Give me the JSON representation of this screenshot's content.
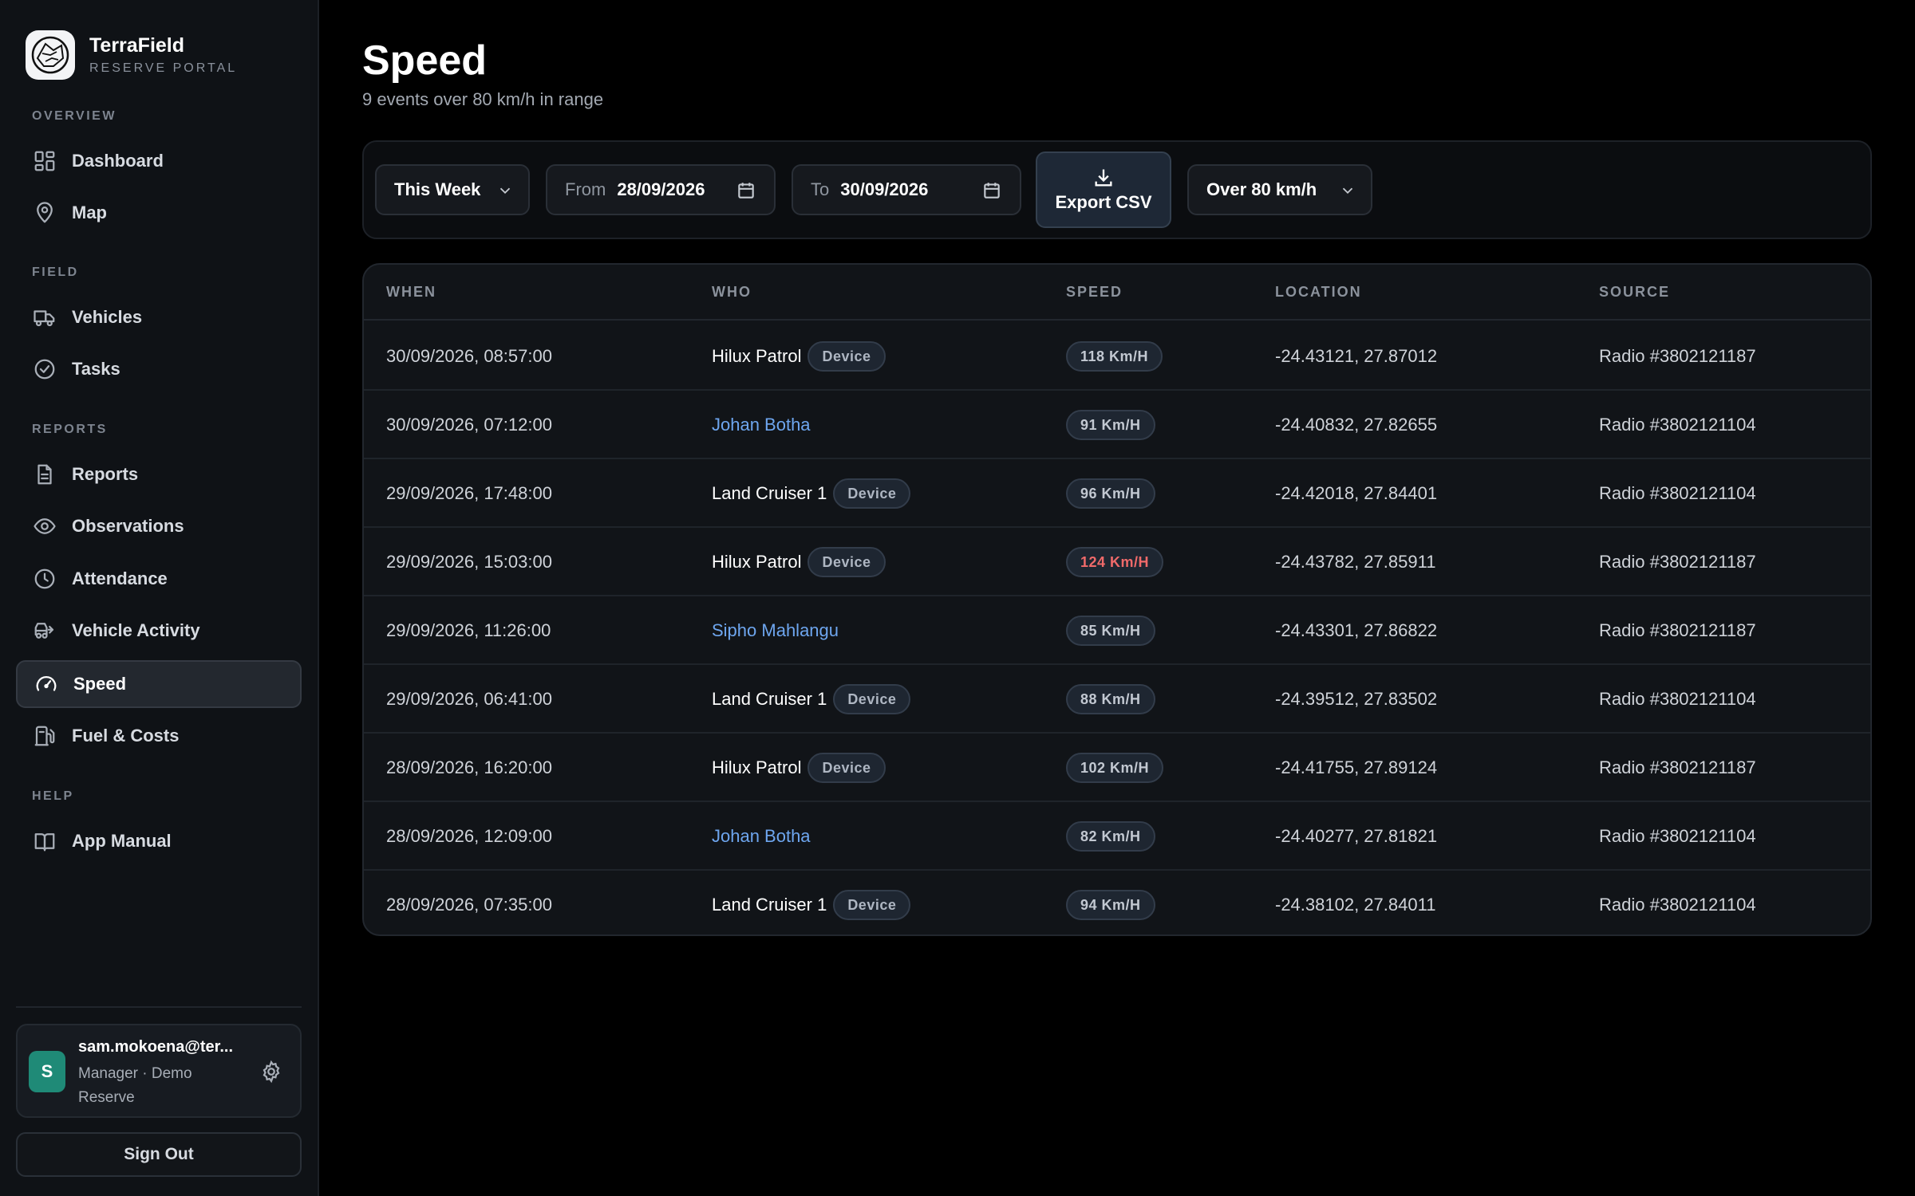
{
  "brand": {
    "name": "TerraField",
    "subtitle": "RESERVE PORTAL"
  },
  "nav": {
    "sections": [
      {
        "label": "OVERVIEW"
      },
      {
        "label": "FIELD"
      },
      {
        "label": "REPORTS"
      },
      {
        "label": "HELP"
      }
    ],
    "items": [
      {
        "label": "Dashboard",
        "icon": "dashboard-icon"
      },
      {
        "label": "Map",
        "icon": "map-pin-icon"
      },
      {
        "label": "Vehicles",
        "icon": "truck-icon"
      },
      {
        "label": "Tasks",
        "icon": "check-circle-icon"
      },
      {
        "label": "Reports",
        "icon": "document-icon"
      },
      {
        "label": "Observations",
        "icon": "eye-icon"
      },
      {
        "label": "Attendance",
        "icon": "clock-icon"
      },
      {
        "label": "Vehicle Activity",
        "icon": "vehicle-activity-icon"
      },
      {
        "label": "Speed",
        "icon": "speedometer-icon",
        "active": true
      },
      {
        "label": "Fuel & Costs",
        "icon": "fuel-icon"
      },
      {
        "label": "App Manual",
        "icon": "book-icon"
      }
    ]
  },
  "user": {
    "initial": "S",
    "email": "sam.mokoena@ter...",
    "role": "Manager · Demo Reserve"
  },
  "sign_out": "Sign Out",
  "page": {
    "title": "Speed",
    "subtitle": "9 events over 80 km/h in range"
  },
  "filters": {
    "period": "This Week",
    "from_label": "From",
    "from_value": "28/09/2026",
    "to_label": "To",
    "to_value": "30/09/2026",
    "export_label": "Export CSV",
    "threshold": "Over 80 km/h"
  },
  "table": {
    "headers": [
      "WHEN",
      "WHO",
      "SPEED",
      "LOCATION",
      "SOURCE"
    ],
    "rows": [
      {
        "when": "30/09/2026, 08:57:00",
        "who": "Hilux Patrol",
        "device": "Device",
        "speed": "118 Km/H",
        "location": "-24.43121, 27.87012",
        "source": "Radio #3802121187"
      },
      {
        "when": "30/09/2026, 07:12:00",
        "who": "Johan Botha",
        "device": "",
        "speed": "91 Km/H",
        "location": "-24.40832, 27.82655",
        "source": "Radio #3802121104"
      },
      {
        "when": "29/09/2026, 17:48:00",
        "who": "Land Cruiser 1",
        "device": "Device",
        "speed": "96 Km/H",
        "location": "-24.42018, 27.84401",
        "source": "Radio #3802121104"
      },
      {
        "when": "29/09/2026, 15:03:00",
        "who": "Hilux Patrol",
        "device": "Device",
        "speed": "124 Km/H",
        "location": "-24.43782, 27.85911",
        "source": "Radio #3802121187"
      },
      {
        "when": "29/09/2026, 11:26:00",
        "who": "Sipho Mahlangu",
        "device": "",
        "speed": "85 Km/H",
        "location": "-24.43301, 27.86822",
        "source": "Radio #3802121187"
      },
      {
        "when": "29/09/2026, 06:41:00",
        "who": "Land Cruiser 1",
        "device": "Device",
        "speed": "88 Km/H",
        "location": "-24.39512, 27.83502",
        "source": "Radio #3802121104"
      },
      {
        "when": "28/09/2026, 16:20:00",
        "who": "Hilux Patrol",
        "device": "Device",
        "speed": "102 Km/H",
        "location": "-24.41755, 27.89124",
        "source": "Radio #3802121187"
      },
      {
        "when": "28/09/2026, 12:09:00",
        "who": "Johan Botha",
        "device": "",
        "speed": "82 Km/H",
        "location": "-24.40277, 27.81821",
        "source": "Radio #3802121104"
      },
      {
        "when": "28/09/2026, 07:35:00",
        "who": "Land Cruiser 1",
        "device": "Device",
        "speed": "94 Km/H",
        "location": "-24.38102, 27.84011",
        "source": "Radio #3802121104"
      }
    ]
  },
  "colors": {
    "accent_link": "#6ea6ef",
    "alert_speed": "#f06a6a",
    "avatar": "#1f8a77"
  }
}
